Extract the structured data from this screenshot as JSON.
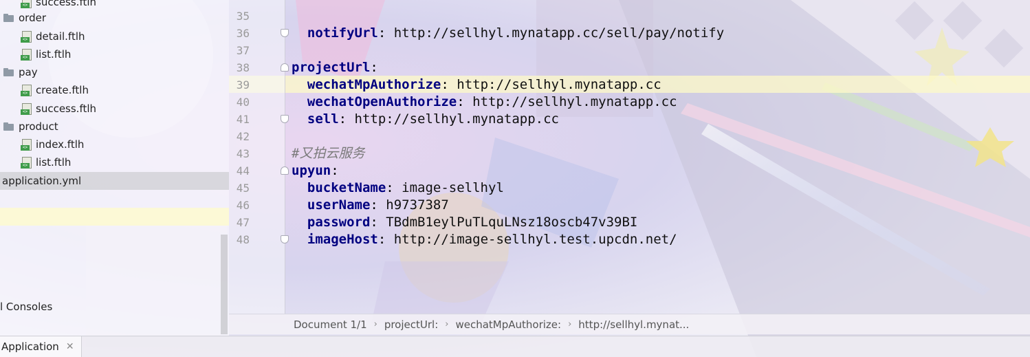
{
  "project_tree": {
    "items": [
      {
        "label": "success.ftlh",
        "kind": "file"
      },
      {
        "label": "order",
        "kind": "folder"
      },
      {
        "label": "detail.ftlh",
        "kind": "file"
      },
      {
        "label": "list.ftlh",
        "kind": "file"
      },
      {
        "label": "pay",
        "kind": "folder"
      },
      {
        "label": "create.ftlh",
        "kind": "file"
      },
      {
        "label": "success.ftlh",
        "kind": "file"
      },
      {
        "label": "product",
        "kind": "folder"
      },
      {
        "label": "index.ftlh",
        "kind": "file"
      },
      {
        "label": "list.ftlh",
        "kind": "file"
      },
      {
        "label": "application.yml",
        "kind": "yml"
      }
    ],
    "consoles_label": "l Consoles"
  },
  "editor": {
    "lines": [
      {
        "num": "35",
        "key": "",
        "value": ""
      },
      {
        "num": "36",
        "indent": "  ",
        "key": "notifyUrl",
        "value": "http://sellhyl.mynatapp.cc/sell/pay/notify"
      },
      {
        "num": "37",
        "key": "",
        "value": ""
      },
      {
        "num": "38",
        "indent": "",
        "key": "projectUrl",
        "value": ""
      },
      {
        "num": "39",
        "indent": "  ",
        "key": "wechatMpAuthorize",
        "value": "http://sellhyl.mynatapp.cc"
      },
      {
        "num": "40",
        "indent": "  ",
        "key": "wechatOpenAuthorize",
        "value": "http://sellhyl.mynatapp.cc"
      },
      {
        "num": "41",
        "indent": "  ",
        "key": "sell",
        "value": "http://sellhyl.mynatapp.cc"
      },
      {
        "num": "42",
        "key": "",
        "value": ""
      },
      {
        "num": "43",
        "comment": "#又拍云服务"
      },
      {
        "num": "44",
        "indent": "",
        "key": "upyun",
        "value": ""
      },
      {
        "num": "45",
        "indent": "  ",
        "key": "bucketName",
        "value": "image-sellhyl"
      },
      {
        "num": "46",
        "indent": "  ",
        "key": "userName",
        "value": "h9737387"
      },
      {
        "num": "47",
        "indent": "  ",
        "key": "password",
        "value": "TBdmB1eylPuTLquLNsz18oscb47v39BI"
      },
      {
        "num": "48",
        "indent": "  ",
        "key": "imageHost",
        "value": "http://image-sellhyl.test.upcdn.net/"
      }
    ]
  },
  "breadcrumb": {
    "items": [
      "Document 1/1",
      "projectUrl:",
      "wechatMpAuthorize:",
      "http://sellhyl.mynat..."
    ],
    "separator": "›"
  },
  "bottom_bar": {
    "run_tab_label": "Application",
    "close_glyph": "✕"
  }
}
